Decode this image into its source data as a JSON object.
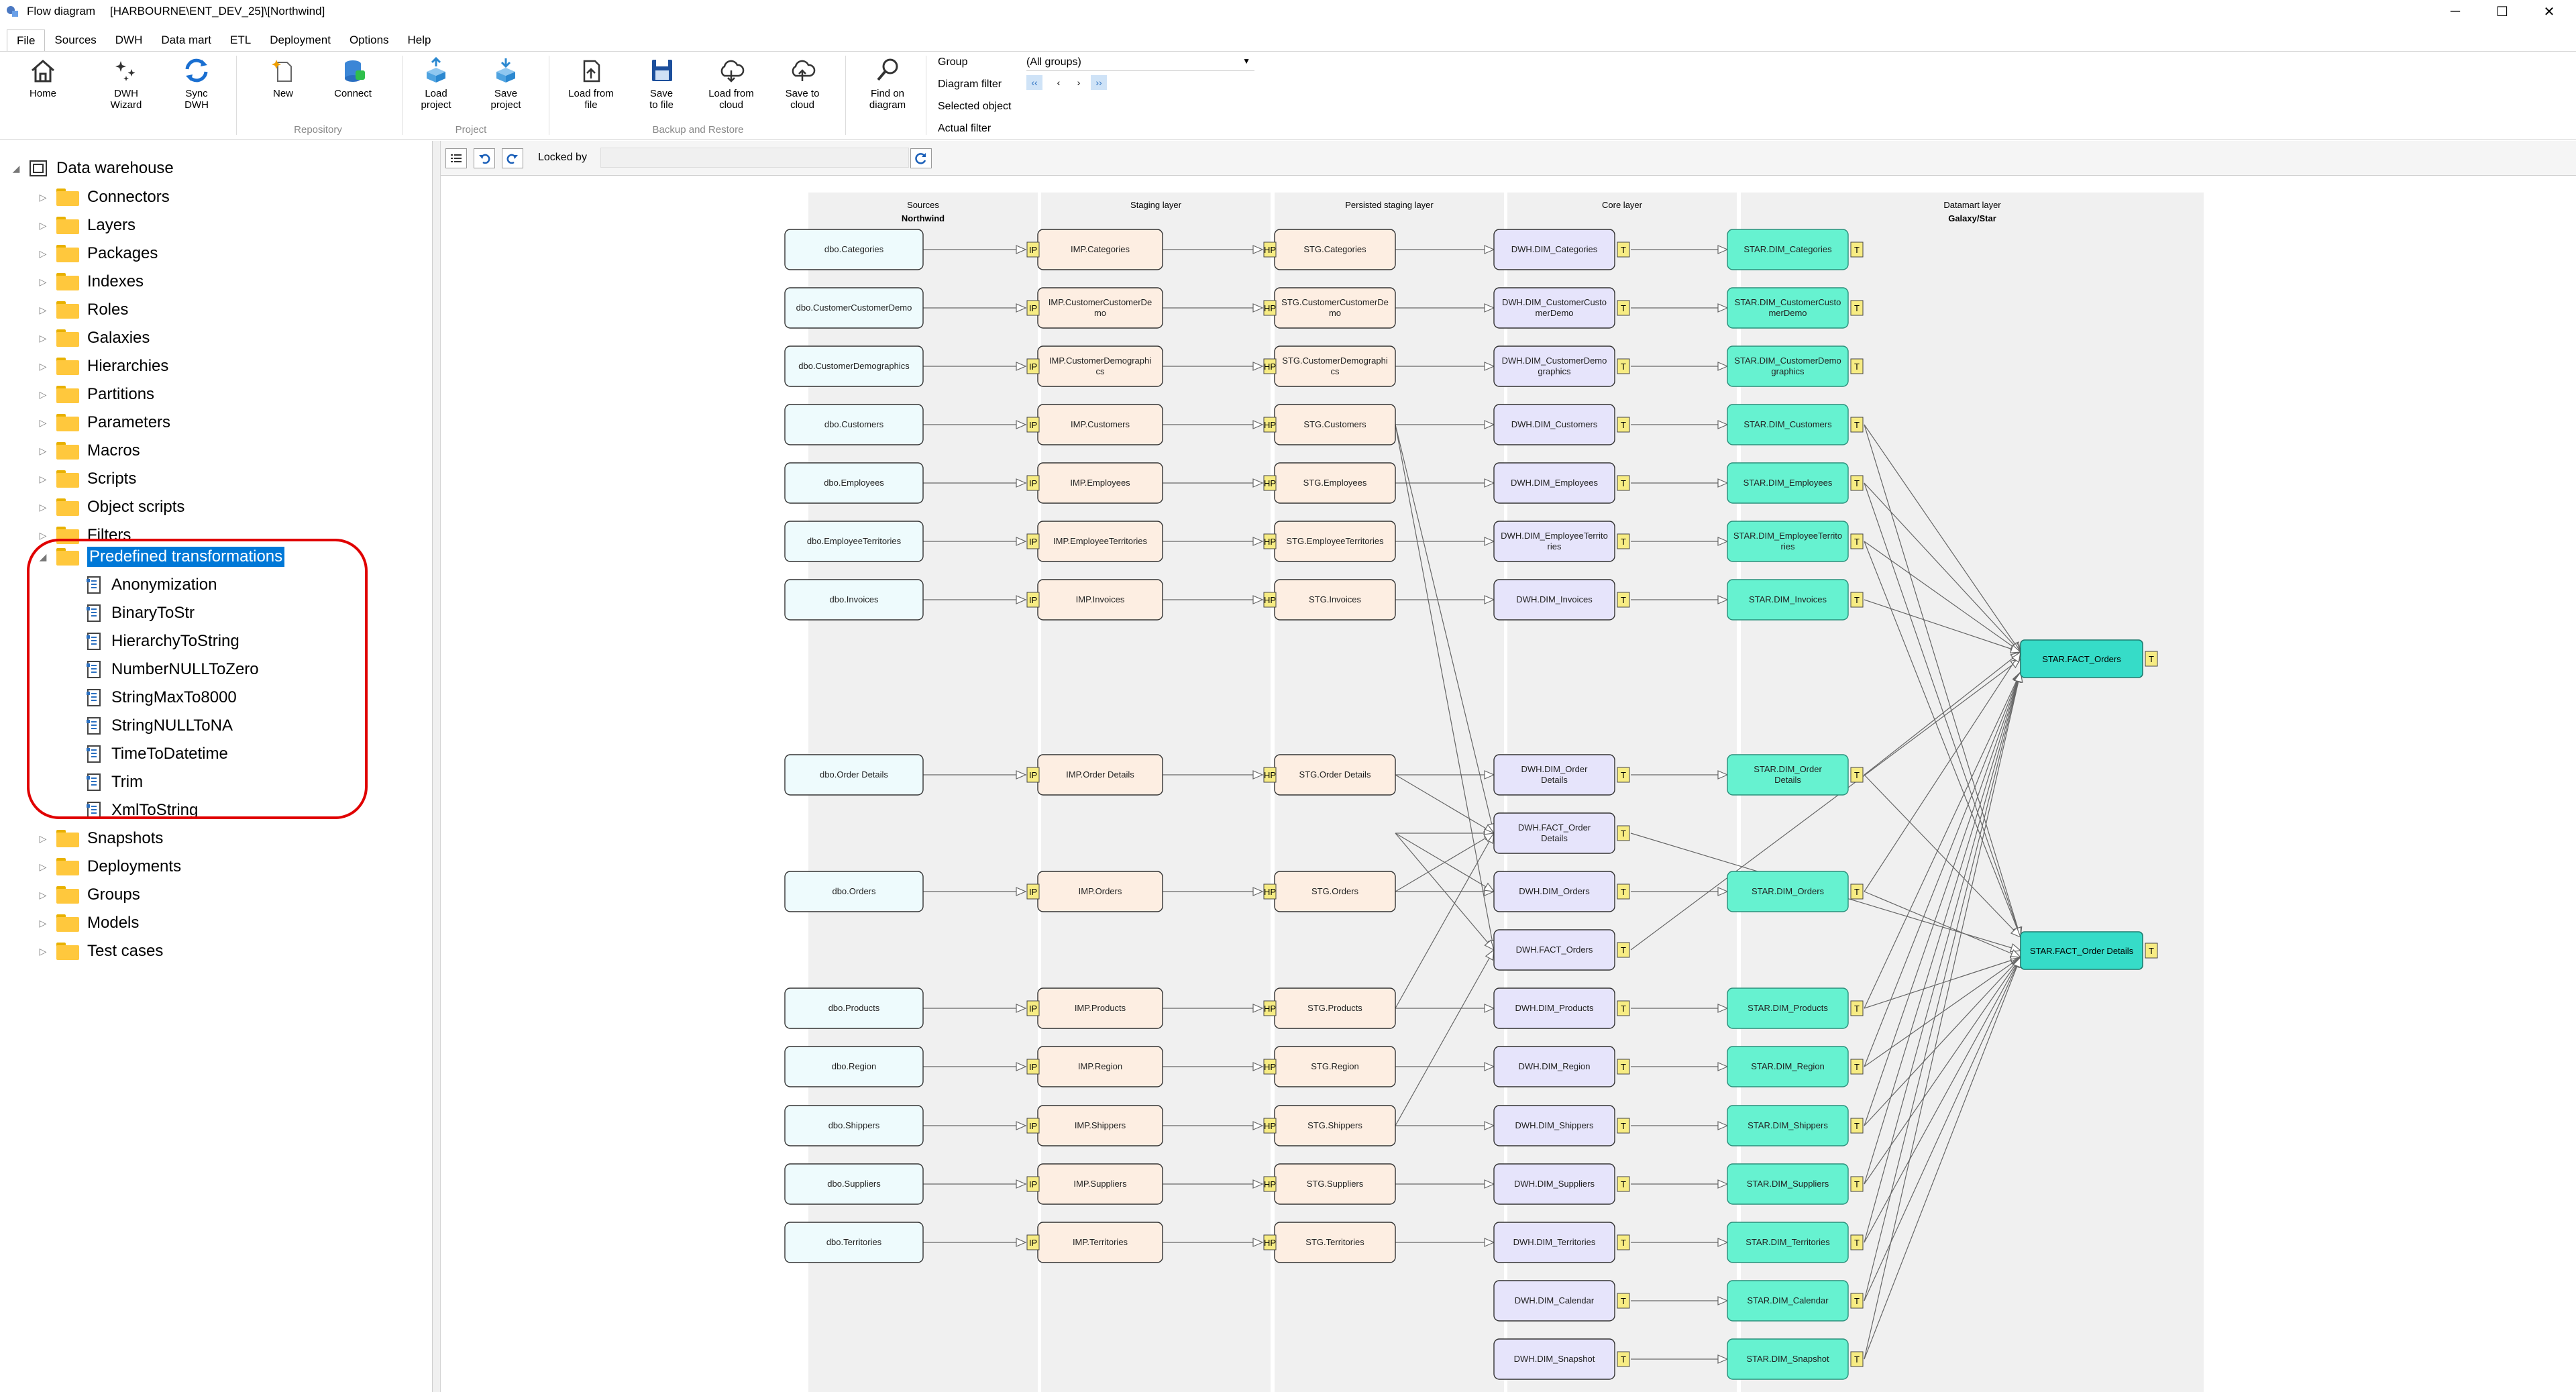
{
  "window": {
    "title": "Flow diagram",
    "server": "[HARBOURNE\\ENT_DEV_25]\\[Northwind]",
    "controls": [
      "─",
      "☐",
      "✕"
    ]
  },
  "menu": [
    "File",
    "Sources",
    "DWH",
    "Data mart",
    "ETL",
    "Deployment",
    "Options",
    "Help"
  ],
  "ribbon": {
    "buttons": [
      {
        "label": "Home",
        "icon": "home-icon"
      },
      {
        "label": "DWH\nWizard",
        "icon": "wizard-icon"
      },
      {
        "label": "Sync\nDWH",
        "icon": "sync-icon"
      },
      {
        "label": "New",
        "icon": "new-icon"
      },
      {
        "label": "Connect",
        "icon": "connect-icon"
      },
      {
        "label": "Load\nproject",
        "icon": "load-project-icon"
      },
      {
        "label": "Save\nproject",
        "icon": "save-project-icon"
      },
      {
        "label": "Load from\nfile",
        "icon": "load-file-icon"
      },
      {
        "label": "Save\nto file",
        "icon": "save-file-icon"
      },
      {
        "label": "Load from\ncloud",
        "icon": "cloud-download-icon"
      },
      {
        "label": "Save to\ncloud",
        "icon": "cloud-upload-icon"
      },
      {
        "label": "Find on\ndiagram",
        "icon": "find-icon"
      }
    ],
    "groups": [
      "Repository",
      "Project",
      "Backup and Restore"
    ],
    "filter_labels": [
      "Group",
      "Diagram filter",
      "Selected object",
      "Actual filter"
    ],
    "group_value": "(All groups)",
    "nav": [
      "‹‹",
      "‹",
      "›",
      "››"
    ]
  },
  "tree": {
    "root": "Data warehouse",
    "top": [
      "Connectors",
      "Layers",
      "Packages",
      "Indexes",
      "Roles",
      "Galaxies",
      "Hierarchies",
      "Partitions",
      "Parameters",
      "Macros",
      "Scripts",
      "Object scripts",
      "Filters"
    ],
    "selected": "Predefined transformations",
    "transformations": [
      "Anonymization",
      "BinaryToStr",
      "HierarchyToString",
      "NumberNULLToZero",
      "StringMaxTo8000",
      "StringNULLToNA",
      "TimeToDatetime",
      "Trim",
      "XmlToString"
    ],
    "bottom": [
      "Snapshots",
      "Deployments",
      "Groups",
      "Models",
      "Test cases"
    ]
  },
  "diagram_toolbar": {
    "locked_label": "Locked by"
  },
  "diagram": {
    "layers": [
      "Sources",
      "Staging layer",
      "Persisted staging layer",
      "Core layer",
      "Datamart layer"
    ],
    "layer_subtitles": {
      "Sources": "Northwind",
      "Datamart layer": "Galaxy/Star"
    },
    "badges": {
      "imp": "IP",
      "stg": "HP",
      "core": "T",
      "dm": "T"
    },
    "sources": [
      "dbo.Categories",
      "dbo.CustomerCustomerDemo",
      "dbo.CustomerDemographics",
      "dbo.Customers",
      "dbo.Employees",
      "dbo.EmployeeTerritories",
      "dbo.Invoices",
      "dbo.Order Details",
      "dbo.Orders",
      "dbo.Products",
      "dbo.Region",
      "dbo.Shippers",
      "dbo.Suppliers",
      "dbo.Territories"
    ],
    "staging": [
      "IMP.Categories",
      "IMP.CustomerCustomerDe mo",
      "IMP.CustomerDemographi cs",
      "IMP.Customers",
      "IMP.Employees",
      "IMP.EmployeeTerritories",
      "IMP.Invoices",
      "IMP.Order Details",
      "IMP.Orders",
      "IMP.Products",
      "IMP.Region",
      "IMP.Shippers",
      "IMP.Suppliers",
      "IMP.Territories"
    ],
    "persisted": [
      "STG.Categories",
      "STG.CustomerCustomerDe mo",
      "STG.CustomerDemographi cs",
      "STG.Customers",
      "STG.Employees",
      "STG.EmployeeTerritories",
      "STG.Invoices",
      "STG.Order Details",
      "STG.Orders",
      "STG.Products",
      "STG.Region",
      "STG.Shippers",
      "STG.Suppliers",
      "STG.Territories"
    ],
    "core": [
      "DWH.DIM_Categories",
      "DWH.DIM_CustomerCusto merDemo",
      "DWH.DIM_CustomerDemo graphics",
      "DWH.DIM_Customers",
      "DWH.DIM_Employees",
      "DWH.DIM_EmployeeTerrito ries",
      "DWH.DIM_Invoices",
      "DWH.DIM_Order Details",
      "DWH.FACT_Order Details",
      "DWH.DIM_Orders",
      "DWH.FACT_Orders",
      "DWH.DIM_Products",
      "DWH.DIM_Region",
      "DWH.DIM_Shippers",
      "DWH.DIM_Suppliers",
      "DWH.DIM_Territories",
      "DWH.DIM_Calendar",
      "DWH.DIM_Snapshot"
    ],
    "datamart": [
      "STAR.DIM_Categories",
      "STAR.DIM_CustomerCusto merDemo",
      "STAR.DIM_CustomerDemo graphics",
      "STAR.DIM_Customers",
      "STAR.DIM_Employees",
      "STAR.DIM_EmployeeTerrito ries",
      "STAR.DIM_Invoices",
      "STAR.DIM_Order Details",
      "STAR.DIM_Orders",
      "STAR.DIM_Products",
      "STAR.DIM_Region",
      "STAR.DIM_Shippers",
      "STAR.DIM_Suppliers",
      "STAR.DIM_Territories",
      "STAR.DIM_Calendar",
      "STAR.DIM_Snapshot"
    ],
    "facts": [
      "STAR.FACT_Orders",
      "STAR.FACT_Order Details"
    ],
    "colors": {
      "source": "#eefbfd",
      "staging": "#fdeee2",
      "persisted": "#fdeee2",
      "core": "#e6e4fb",
      "datamart": "#66f2d0",
      "fact": "#36dcc8",
      "badge": "#f7ec83",
      "lane": "#f0f0f0"
    }
  }
}
